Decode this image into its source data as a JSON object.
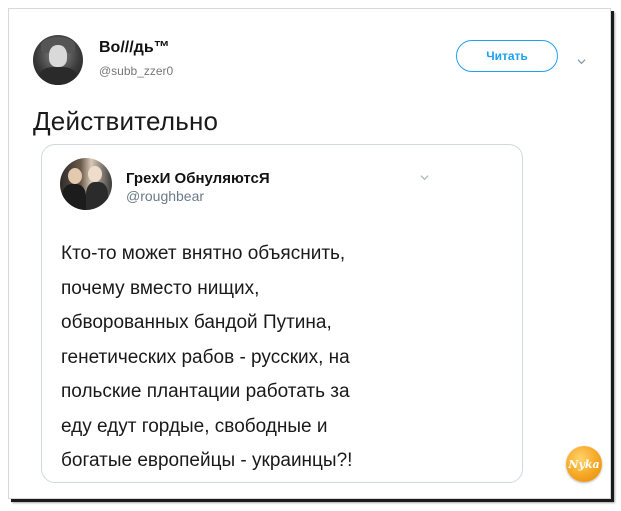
{
  "tweet": {
    "author_name": "Во///дь™",
    "author_handle": "@subb_zzer0",
    "follow_label": "Читать",
    "text": "Действительно"
  },
  "quoted_tweet": {
    "author_name": "ГрехИ ОбнуляютсЯ",
    "author_handle": "@roughbear",
    "lines": [
      "Кто-то может внятно объяснить,",
      "почему вместо нищих,",
      "обворованных бандой Путина,",
      "генетических рабов - русских, на",
      "польские плантации работать за",
      "еду едут гордые, свободные и",
      "богатые европейцы - украинцы?!"
    ]
  },
  "watermark": {
    "text": "Nyka"
  },
  "colors": {
    "accent": "#1da1f2",
    "text": "#1a1a1a",
    "muted": "#6b7a87"
  }
}
